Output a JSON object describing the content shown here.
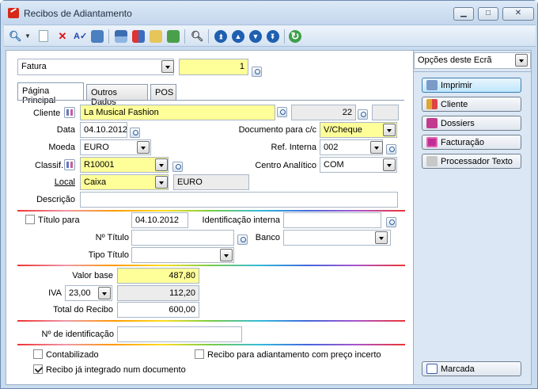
{
  "window": {
    "title": "Recibos de Adiantamento",
    "min": "▁",
    "max": "□",
    "close": "✕"
  },
  "toolbar": {
    "icons": [
      "search-icon",
      "new-document-icon",
      "delete-icon",
      "spell-check-icon",
      "form-icon",
      "table-icon",
      "users-icon",
      "print-preview-icon",
      "report-icon",
      "magnifier-icon",
      "first-record-icon",
      "previous-record-icon",
      "next-record-icon",
      "last-record-icon",
      "refresh-icon"
    ]
  },
  "doc_type": {
    "value": "Fatura",
    "number": "1"
  },
  "tabs": [
    {
      "label": "Página Principal"
    },
    {
      "label": "Outros Dados"
    },
    {
      "label": "POS"
    }
  ],
  "form": {
    "cliente": {
      "label": "Cliente",
      "value": "La Musical Fashion",
      "number": "22"
    },
    "data": {
      "label": "Data",
      "value": "04.10.2012"
    },
    "documento": {
      "label": "Documento para c/c",
      "value": "V/Cheque"
    },
    "moeda": {
      "label": "Moeda",
      "value": "EURO"
    },
    "ref_interna": {
      "label": "Ref. Interna",
      "value": "002"
    },
    "classif": {
      "label": "Classif.",
      "value": "R10001"
    },
    "centro": {
      "label": "Centro Analítico",
      "value": "COM"
    },
    "local": {
      "label": "Local",
      "value": "Caixa",
      "currency": "EURO"
    },
    "descricao": {
      "label": "Descrição",
      "value": ""
    }
  },
  "titulo": {
    "checkbox_label": "Título para",
    "checked": false,
    "date": "04.10.2012",
    "ident_label": "Identificação interna",
    "ident_value": "",
    "numero_label": "Nº Título",
    "numero_value": "",
    "banco_label": "Banco",
    "banco_value": "",
    "tipo_label": "Tipo Título",
    "tipo_value": ""
  },
  "valores": {
    "base_label": "Valor base",
    "base_value": "487,80",
    "iva_label": "IVA",
    "iva_rate": "23,00",
    "iva_value": "112,20",
    "total_label": "Total do Recibo",
    "total_value": "600,00"
  },
  "identificacao": {
    "label": "Nº de identificação",
    "value": ""
  },
  "flags": {
    "contabilizado": {
      "label": "Contabilizado",
      "checked": false
    },
    "incerto": {
      "label": "Recibo para adiantamento com preço incerto",
      "checked": false
    },
    "integrado": {
      "label": "Recibo já integrado num documento",
      "checked": true
    }
  },
  "side_panel": {
    "dropdown": "Opções deste Ecrã",
    "buttons": [
      {
        "label": "Imprimir"
      },
      {
        "label": "Cliente"
      },
      {
        "label": "Dossiers"
      },
      {
        "label": "Facturação"
      },
      {
        "label": "Processador Texto"
      }
    ],
    "bottom_button": "Marcada"
  },
  "colors": {
    "highlight": "#ffff99",
    "panel": "#dbe7f4",
    "accent": "#3c7fb1"
  }
}
